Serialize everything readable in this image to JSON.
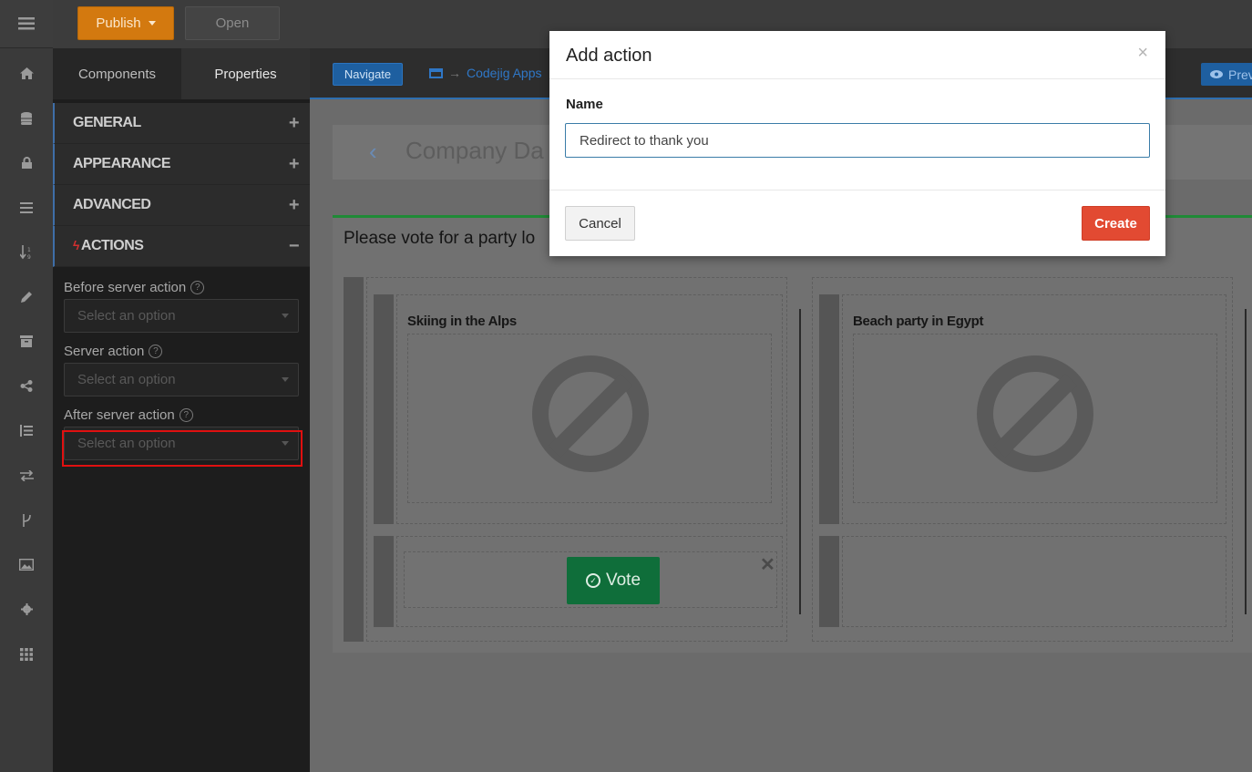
{
  "topbar": {
    "publish_label": "Publish",
    "open_label": "Open"
  },
  "panel": {
    "tabs": [
      {
        "label": "Components"
      },
      {
        "label": "Properties"
      }
    ],
    "sections": [
      {
        "label": "GENERAL",
        "toggle": "+"
      },
      {
        "label": "APPEARANCE",
        "toggle": "+"
      },
      {
        "label": "ADVANCED",
        "toggle": "+"
      },
      {
        "label": "ACTIONS",
        "toggle": "−"
      }
    ],
    "fields": [
      {
        "label": "Before server action",
        "placeholder": "Select an option"
      },
      {
        "label": "Server action",
        "placeholder": "Select an option"
      },
      {
        "label": "After server action",
        "placeholder": "Select an option"
      }
    ]
  },
  "canvas": {
    "navigate_label": "Navigate",
    "breadcrumb": "Codejig Apps",
    "preview_label": "Prev",
    "page_title": "Company Da",
    "card_title": "Please vote for a party lo",
    "items": [
      {
        "title": "Skiing in the Alps"
      },
      {
        "title": "Beach party in Egypt"
      }
    ],
    "vote_label": "Vote"
  },
  "modal": {
    "title": "Add action",
    "close": "×",
    "name_label": "Name",
    "name_value": "Redirect to thank you",
    "cancel_label": "Cancel",
    "create_label": "Create"
  },
  "icons": {
    "rail": [
      "menu-icon",
      "home-icon",
      "database-icon",
      "lock-icon",
      "list-icon",
      "sort-icon",
      "pencil-icon",
      "archive-icon",
      "share-icon",
      "list-ordered-icon",
      "exchange-icon",
      "branch-icon",
      "image-icon",
      "gear-icon",
      "grid-icon"
    ]
  }
}
